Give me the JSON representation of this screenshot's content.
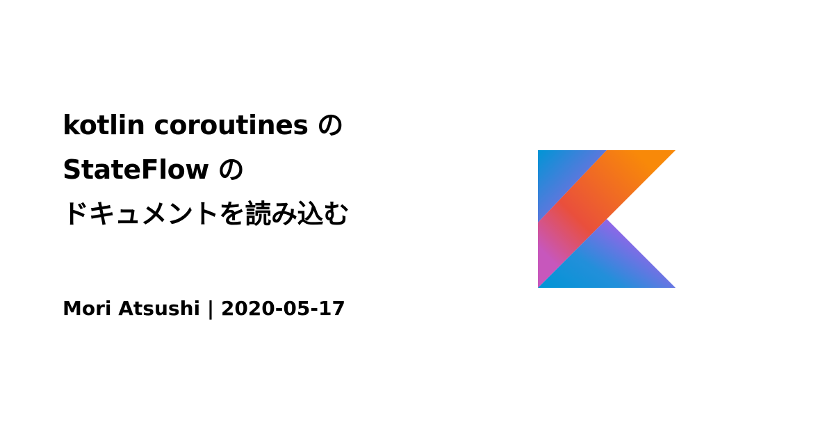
{
  "title": {
    "lines": [
      "kotlin coroutines の",
      "StateFlow の",
      "ドキュメントを読み込む"
    ]
  },
  "byline": {
    "author": "Mori Atsushi",
    "separator": " | ",
    "date": "2020-05-17"
  },
  "logo": {
    "icon": "kotlin-logo-icon",
    "colors": {
      "orange": "#F88909",
      "orange_red": "#E94F3C",
      "magenta": "#C757BC",
      "purple": "#7F6CE0",
      "violet": "#9265E8",
      "blue": "#0095D5",
      "blue_light": "#238FDA"
    }
  }
}
